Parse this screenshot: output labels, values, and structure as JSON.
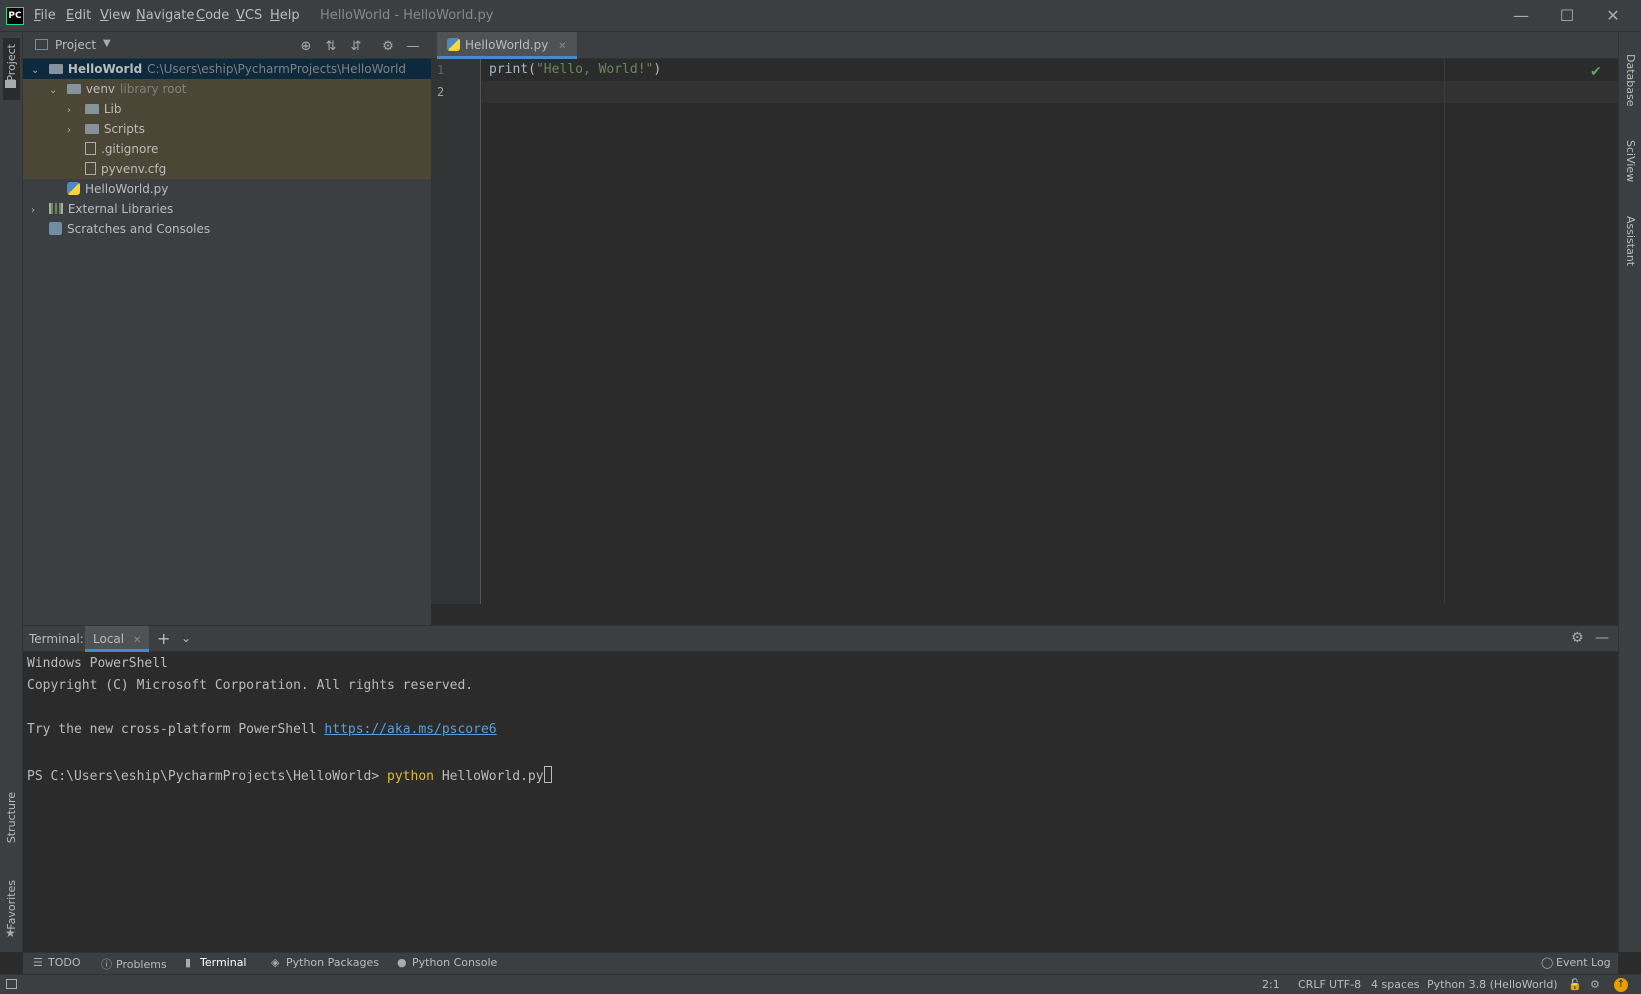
{
  "app": {
    "logo_text": "PC",
    "window_title": "HelloWorld - HelloWorld.py"
  },
  "menu": [
    "File",
    "Edit",
    "View",
    "Navigate",
    "Code",
    "VCS",
    "Help"
  ],
  "left_strip": {
    "project": "Project",
    "structure": "Structure",
    "favorites": "Favorites"
  },
  "right_strip": {
    "database": "Database",
    "sciview": "SciView",
    "assistant": "Assistant"
  },
  "project_panel": {
    "title": "Project",
    "tree": {
      "root_name": "HelloWorld",
      "root_path": "C:\\Users\\eship\\PycharmProjects\\HelloWorld",
      "venv_name": "venv",
      "venv_hint": "library root",
      "lib": "Lib",
      "scripts": "Scripts",
      "gitignore": ".gitignore",
      "pyvenv": "pyvenv.cfg",
      "hello_file": "HelloWorld.py",
      "external_libs": "External Libraries",
      "scratches": "Scratches and Consoles"
    }
  },
  "editor": {
    "tab_label": "HelloWorld.py",
    "line_numbers": [
      "1",
      "2"
    ],
    "code_fn": "print(",
    "code_str": "\"Hello, World!\"",
    "code_close": ")"
  },
  "terminal": {
    "label": "Terminal:",
    "tab": "Local",
    "lines": {
      "l1": "Windows PowerShell",
      "l2": "Copyright (C) Microsoft Corporation. All rights reserved.",
      "l3_text": "Try the new cross-platform PowerShell ",
      "l3_link": "https://aka.ms/pscore6",
      "prompt": "PS C:\\Users\\eship\\PycharmProjects\\HelloWorld> ",
      "cmd": "python",
      "arg": " HelloWorld.py"
    }
  },
  "bottom_tabs": {
    "todo": "TODO",
    "problems": "Problems",
    "terminal": "Terminal",
    "python_packages": "Python Packages",
    "python_console": "Python Console",
    "event_log": "Event Log"
  },
  "status": {
    "position": "2:1",
    "line_sep": "CRLF",
    "encoding": "UTF-8",
    "indent": "4 spaces",
    "interpreter": "Python 3.8 (HelloWorld)"
  }
}
